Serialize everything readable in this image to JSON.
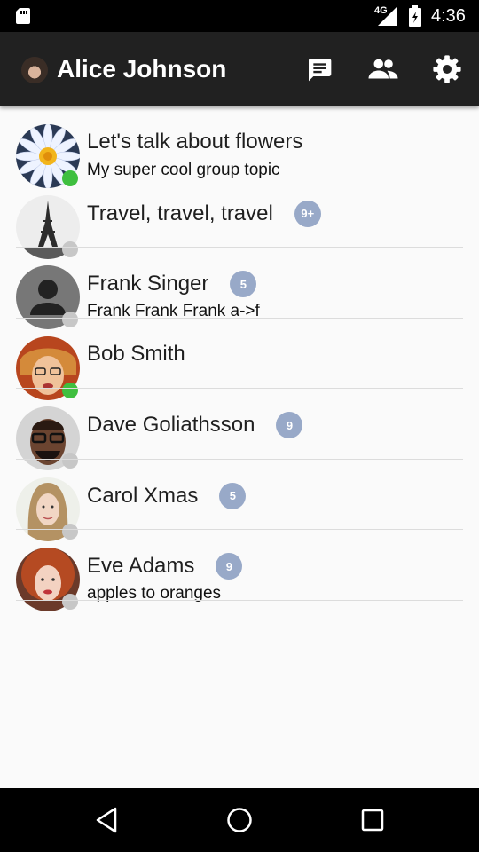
{
  "status_bar": {
    "network": "4G",
    "time": "4:36",
    "icons": [
      "sd-card-icon",
      "signal-icon",
      "battery-icon"
    ]
  },
  "app_bar": {
    "title": "Alice Johnson",
    "actions": [
      {
        "icon": "chat-icon"
      },
      {
        "icon": "people-icon"
      },
      {
        "icon": "settings-icon"
      }
    ]
  },
  "colors": {
    "app_bar": "#212121",
    "online": "#3fbf3f",
    "offline": "#c7c7c7",
    "badge": "#98a9c8",
    "background": "#fafafa"
  },
  "chats": [
    {
      "title": "Let's talk about flowers",
      "subtitle": "My super cool group topic",
      "badge": "",
      "online": true,
      "avatar": "flower-photo"
    },
    {
      "title": "Travel, travel, travel",
      "subtitle": "",
      "badge": "9+",
      "online": false,
      "avatar": "eiffel-tower-photo"
    },
    {
      "title": "Frank Singer",
      "subtitle": "Frank Frank Frank a->f",
      "badge": "5",
      "online": false,
      "avatar": "default-person-icon"
    },
    {
      "title": "Bob Smith",
      "subtitle": "",
      "badge": "",
      "online": true,
      "avatar": "bob-photo"
    },
    {
      "title": "Dave Goliathsson",
      "subtitle": "",
      "badge": "9",
      "online": false,
      "avatar": "dave-photo"
    },
    {
      "title": "Carol Xmas",
      "subtitle": "",
      "badge": "5",
      "online": false,
      "avatar": "carol-photo"
    },
    {
      "title": "Eve Adams",
      "subtitle": "apples to oranges",
      "badge": "9",
      "online": false,
      "avatar": "eve-photo"
    }
  ],
  "nav_bar": {
    "buttons": [
      "back-icon",
      "home-icon",
      "recent-apps-icon"
    ]
  }
}
